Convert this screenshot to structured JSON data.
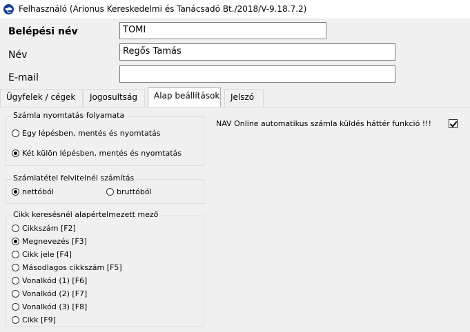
{
  "window": {
    "title": "Felhasználó (Arionus Kereskedelmi és Tanácsadó Bt./2018/V-9.18.7.2)"
  },
  "fields": {
    "login": {
      "label": "Belépési név",
      "value": "TOMI"
    },
    "name": {
      "label": "Név",
      "value": "Regős Tamás"
    },
    "email": {
      "label": "E-mail",
      "value": ""
    }
  },
  "tabs": [
    "Ügyfelek / cégek",
    "Jogosultság",
    "Alap beállítások",
    "Jelszó"
  ],
  "active_tab": "Alap beállítások",
  "groups": {
    "print_flow": {
      "title": "Számla nyomtatás folyamata",
      "options": [
        "Egy lépésben, mentés és nyomtatás",
        "Két külön lépésben, mentés és nyomtatás"
      ],
      "selected": "Két külön lépésben, mentés és nyomtatás"
    },
    "item_calc": {
      "title": "Számlatétel felvitelnél  számítás",
      "options": [
        "nettóból",
        "bruttóból"
      ],
      "selected": "nettóból"
    },
    "search_field": {
      "title": "Cikk keresésnél alapértelmezett mező",
      "options": [
        "Cikkszám [F2]",
        "Megnevezés [F3]",
        "Cikk jele [F4]",
        "Másodlagos cikkszám [F5]",
        "Vonalkód (1) [F6]",
        "Vonalkód (2) [F7]",
        "Vonalkód (3) [F8]",
        "Cikk [F9]"
      ],
      "selected": "Megnevezés [F3]"
    }
  },
  "nav_online": {
    "label": "NAV Online automatikus számla küldés háttér funkció  !!!",
    "checked": true
  }
}
